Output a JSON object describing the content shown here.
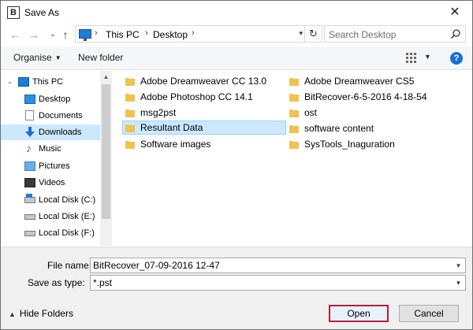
{
  "window": {
    "title": "Save As",
    "app_icon": "B",
    "close_glyph": "✕"
  },
  "nav": {
    "back_glyph": "←",
    "forward_glyph": "→",
    "recent_glyph": "⌄",
    "up_glyph": "↑",
    "breadcrumbs": [
      "This PC",
      "Desktop"
    ],
    "refresh_glyph": "↻",
    "search_placeholder": "Search Desktop"
  },
  "toolbar": {
    "organise_label": "Organise",
    "new_folder_label": "New folder",
    "help_glyph": "?"
  },
  "sidebar": {
    "items": [
      {
        "label": "This PC",
        "icon": "pc-icon"
      },
      {
        "label": "Desktop",
        "icon": "desktop-icon"
      },
      {
        "label": "Documents",
        "icon": "documents-icon"
      },
      {
        "label": "Downloads",
        "icon": "downloads-icon",
        "selected": true
      },
      {
        "label": "Music",
        "icon": "music-icon"
      },
      {
        "label": "Pictures",
        "icon": "pictures-icon"
      },
      {
        "label": "Videos",
        "icon": "videos-icon"
      },
      {
        "label": "Local Disk (C:)",
        "icon": "disk-icon"
      },
      {
        "label": "Local Disk (E:)",
        "icon": "disk-icon"
      },
      {
        "label": "Local Disk (F:)",
        "icon": "disk-icon"
      }
    ]
  },
  "files": [
    {
      "name": "Adobe Dreamweaver CC 13.0",
      "type": "folder"
    },
    {
      "name": "Adobe Photoshop CC 14.1",
      "type": "folder"
    },
    {
      "name": "msg2pst",
      "type": "folder"
    },
    {
      "name": "Resultant Data",
      "type": "folder",
      "selected": true
    },
    {
      "name": "Software images",
      "type": "folder"
    },
    {
      "name": "Adobe Dreamweaver CS5",
      "type": "folder"
    },
    {
      "name": "BitRecover-6-5-2016 4-18-54",
      "type": "folder"
    },
    {
      "name": "ost",
      "type": "folder"
    },
    {
      "name": "software content",
      "type": "folder"
    },
    {
      "name": "SysTools_Inaguration",
      "type": "folder"
    }
  ],
  "form": {
    "file_name_label": "File name:",
    "file_name_value": "BitRecover_07-09-2016 12-47",
    "save_type_label": "Save as type:",
    "save_type_value": "*.pst"
  },
  "footer": {
    "hide_folders_label": "Hide Folders",
    "open_label": "Open",
    "cancel_label": "Cancel"
  },
  "colors": {
    "selection": "#cce8ff",
    "accent": "#1a6fd1",
    "folder": "#f0c24e",
    "open_border": "#c0193a"
  }
}
